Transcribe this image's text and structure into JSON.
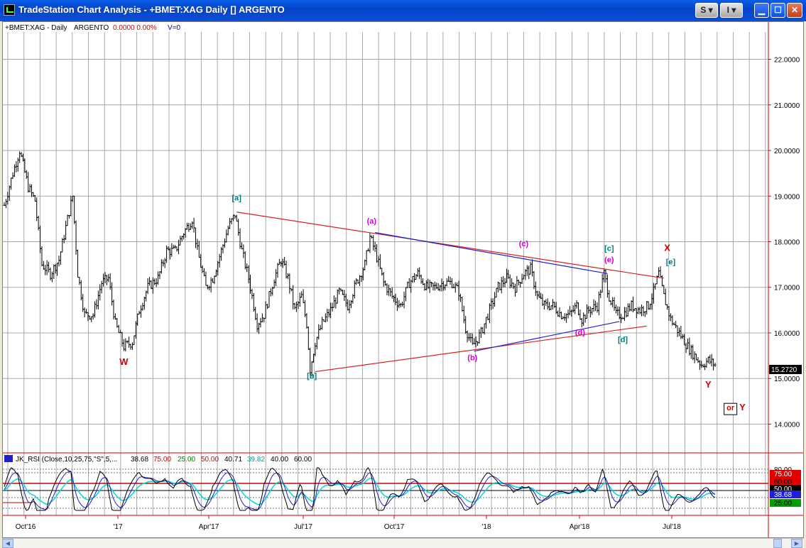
{
  "window": {
    "title": "TradeStation Chart Analysis - +BMET:XAG Daily [] ARGENTO",
    "s_button": "S",
    "i_button": "I"
  },
  "price_panel": {
    "header": {
      "symbol": "+BMET:XAG - Daily",
      "name": "ARGENTO",
      "values": "0.0000  0.00%",
      "volume": "V=0"
    },
    "last_price": "15.2720"
  },
  "rsi_panel": {
    "header": {
      "study": "JK_RSI (Close,10,25,75,\"S\",5,...",
      "v1": "38.68",
      "v2": "75.00",
      "v3": "25.00",
      "v4": "50.00",
      "v5": "40.71",
      "v6": "39.82",
      "v7": "40.00",
      "v8": "60.00"
    },
    "axis_labels": [
      "80.00",
      "75.00",
      "60.00",
      "50.00",
      "40.00",
      "38.68",
      "25.00"
    ],
    "colors": {
      "rsi": "#000000",
      "signal": "#1e1ec8",
      "cyan": "#00d8d8",
      "red": "#e00000"
    }
  },
  "chart_data": {
    "type": "bar",
    "subtype": "ohlc",
    "price_axis": {
      "ylim": [
        13.4,
        22.6
      ],
      "ticks": [
        "22.0000",
        "21.0000",
        "20.0000",
        "19.0000",
        "18.0000",
        "17.0000",
        "16.0000",
        "15.0000",
        "14.0000"
      ]
    },
    "x_axis": {
      "ticks": [
        "Oct'16",
        "'17",
        "Apr'17",
        "Jul'17",
        "Oct'17",
        "'18",
        "Apr'18",
        "Jul'18"
      ]
    },
    "price_path": [
      [
        0,
        18.8
      ],
      [
        5,
        19.5
      ],
      [
        9,
        20
      ],
      [
        14,
        19.2
      ],
      [
        18,
        18.9
      ],
      [
        22,
        17.5
      ],
      [
        27,
        17.3
      ],
      [
        32,
        17.6
      ],
      [
        37,
        18.5
      ],
      [
        40,
        19
      ],
      [
        43,
        17.3
      ],
      [
        47,
        16.4
      ],
      [
        52,
        16.4
      ],
      [
        57,
        17.1
      ],
      [
        61,
        17.2
      ],
      [
        65,
        16.2
      ],
      [
        70,
        15.7
      ],
      [
        75,
        15.8
      ],
      [
        79,
        16.5
      ],
      [
        84,
        17
      ],
      [
        90,
        17.2
      ],
      [
        95,
        17.8
      ],
      [
        100,
        17.8
      ],
      [
        105,
        18.2
      ],
      [
        110,
        18.5
      ],
      [
        113,
        17.8
      ],
      [
        118,
        17
      ],
      [
        122,
        17.2
      ],
      [
        127,
        17.8
      ],
      [
        131,
        18.3
      ],
      [
        135,
        18.6
      ],
      [
        139,
        17.8
      ],
      [
        143,
        17.2
      ],
      [
        148,
        16.2
      ],
      [
        152,
        16.4
      ],
      [
        158,
        17.2
      ],
      [
        162,
        17.6
      ],
      [
        166,
        17.2
      ],
      [
        170,
        16.5
      ],
      [
        174,
        16.8
      ],
      [
        177,
        16.2
      ],
      [
        179,
        15.2
      ],
      [
        182,
        15.8
      ],
      [
        186,
        16.2
      ],
      [
        191,
        16.5
      ],
      [
        196,
        16.9
      ],
      [
        201,
        16.6
      ],
      [
        206,
        17.1
      ],
      [
        211,
        17.5
      ],
      [
        214,
        18.1
      ],
      [
        217,
        17.8
      ],
      [
        222,
        17.1
      ],
      [
        227,
        16.8
      ],
      [
        232,
        16.6
      ],
      [
        237,
        17.1
      ],
      [
        242,
        17.3
      ],
      [
        247,
        17
      ],
      [
        252,
        17
      ],
      [
        257,
        17.1
      ],
      [
        262,
        17.1
      ],
      [
        266,
        16.9
      ],
      [
        270,
        16.1
      ],
      [
        274,
        15.7
      ],
      [
        279,
        16
      ],
      [
        284,
        16.5
      ],
      [
        289,
        17
      ],
      [
        294,
        17.2
      ],
      [
        299,
        17
      ],
      [
        304,
        17.3
      ],
      [
        308,
        17.4
      ],
      [
        312,
        16.8
      ],
      [
        316,
        16.6
      ],
      [
        321,
        16.6
      ],
      [
        326,
        16.4
      ],
      [
        331,
        16.4
      ],
      [
        335,
        16.6
      ],
      [
        338,
        16.3
      ],
      [
        342,
        16.5
      ],
      [
        347,
        16.6
      ],
      [
        351,
        17.3
      ],
      [
        354,
        16.8
      ],
      [
        358,
        16.4
      ],
      [
        362,
        16.4
      ],
      [
        367,
        16.6
      ],
      [
        372,
        16.5
      ],
      [
        377,
        16.6
      ],
      [
        380,
        16.9
      ],
      [
        383,
        17.3
      ],
      [
        386,
        16.8
      ],
      [
        390,
        16.3
      ],
      [
        395,
        16
      ],
      [
        400,
        15.7
      ],
      [
        404,
        15.5
      ],
      [
        408,
        15.3
      ],
      [
        412,
        15.4
      ],
      [
        416,
        15.3
      ]
    ],
    "annotations": [
      {
        "label": "W",
        "x": 70,
        "y": 15.3,
        "color": "#d40000"
      },
      {
        "label": "[a]",
        "x": 136,
        "y": 18.9,
        "color": "#008080"
      },
      {
        "label": "[b]",
        "x": 180,
        "y": 15.0,
        "color": "#008080"
      },
      {
        "label": "(a)",
        "x": 215,
        "y": 18.4,
        "color": "#d000d0"
      },
      {
        "label": "(b)",
        "x": 274,
        "y": 15.4,
        "color": "#d000d0"
      },
      {
        "label": "(c)",
        "x": 304,
        "y": 17.9,
        "color": "#d000d0"
      },
      {
        "label": "[c]",
        "x": 354,
        "y": 17.8,
        "color": "#008080"
      },
      {
        "label": "(e)",
        "x": 354,
        "y": 17.55,
        "color": "#d000d0"
      },
      {
        "label": "(d)",
        "x": 337,
        "y": 15.95,
        "color": "#d000d0"
      },
      {
        "label": "[d]",
        "x": 362,
        "y": 15.8,
        "color": "#008080"
      },
      {
        "label": "X",
        "x": 388,
        "y": 17.8,
        "color": "#d40000"
      },
      {
        "label": "[e]",
        "x": 390,
        "y": 17.5,
        "color": "#008080"
      },
      {
        "label": "Y",
        "x": 412,
        "y": 14.8,
        "color": "#d40000"
      },
      {
        "label": "or",
        "x": 425,
        "y": 14.3,
        "color": "#d40000"
      },
      {
        "label": "Y",
        "x": 432,
        "y": 14.3,
        "color": "#d40000"
      }
    ],
    "trendlines": [
      {
        "x1": 136,
        "y1": 18.65,
        "x2": 386,
        "y2": 17.2,
        "color": "#d82020"
      },
      {
        "x1": 182,
        "y1": 15.15,
        "x2": 376,
        "y2": 16.15,
        "color": "#d82020"
      },
      {
        "x1": 217,
        "y1": 18.2,
        "x2": 353,
        "y2": 17.3,
        "color": "#2020c8"
      },
      {
        "x1": 275,
        "y1": 15.6,
        "x2": 360,
        "y2": 16.25,
        "color": "#2020c8"
      }
    ]
  }
}
